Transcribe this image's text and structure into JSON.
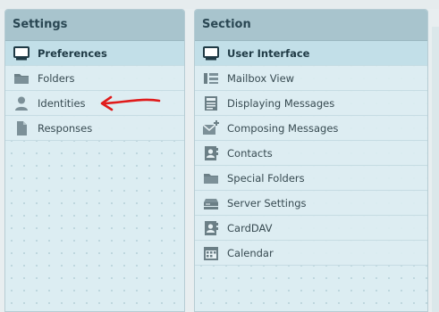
{
  "settings": {
    "title": "Settings",
    "items": [
      {
        "label": "Preferences",
        "icon": "monitor-icon",
        "selected": true
      },
      {
        "label": "Folders",
        "icon": "folder-icon"
      },
      {
        "label": "Identities",
        "icon": "person-icon"
      },
      {
        "label": "Responses",
        "icon": "document-icon"
      }
    ]
  },
  "section": {
    "title": "Section",
    "items": [
      {
        "label": "User Interface",
        "icon": "monitor-icon",
        "selected": true
      },
      {
        "label": "Mailbox View",
        "icon": "list-layout-icon"
      },
      {
        "label": "Displaying Messages",
        "icon": "message-view-icon"
      },
      {
        "label": "Composing Messages",
        "icon": "compose-envelope-icon"
      },
      {
        "label": "Contacts",
        "icon": "contact-card-icon"
      },
      {
        "label": "Special Folders",
        "icon": "folder-icon"
      },
      {
        "label": "Server Settings",
        "icon": "server-icon"
      },
      {
        "label": "CardDAV",
        "icon": "contact-card-icon"
      },
      {
        "label": "Calendar",
        "icon": "calendar-icon"
      }
    ]
  },
  "colors": {
    "header_bg": "#a8c4cd",
    "panel_bg": "#dcedf2",
    "selected_bg": "#c2dfe8",
    "annotation_arrow": "#e01b1b"
  }
}
